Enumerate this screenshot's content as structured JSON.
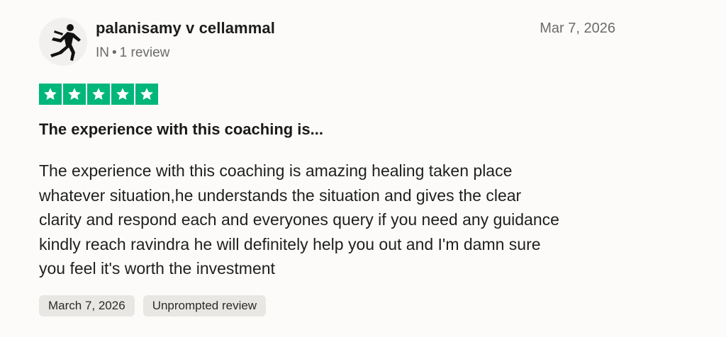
{
  "reviewer": {
    "name": "palanisamy v cellammal",
    "country": "IN",
    "separator": "•",
    "review_count": "1 review",
    "avatar_icon": "runner-silhouette-icon"
  },
  "review": {
    "date": "Mar 7, 2026",
    "rating": 5,
    "rating_max": 5,
    "star_color": "#00b67a",
    "title": "The experience with this coaching is...",
    "lines": [
      "The experience with this coaching is amazing healing taken place",
      "whatever situation,he understands the situation and gives the clear",
      "clarity and respond each and everyones query if you need any guidance",
      "kindly reach ravindra he will definitely help you out and I'm damn sure",
      "you feel it's worth the investment"
    ],
    "tags": [
      "March 7, 2026",
      "Unprompted review"
    ]
  }
}
